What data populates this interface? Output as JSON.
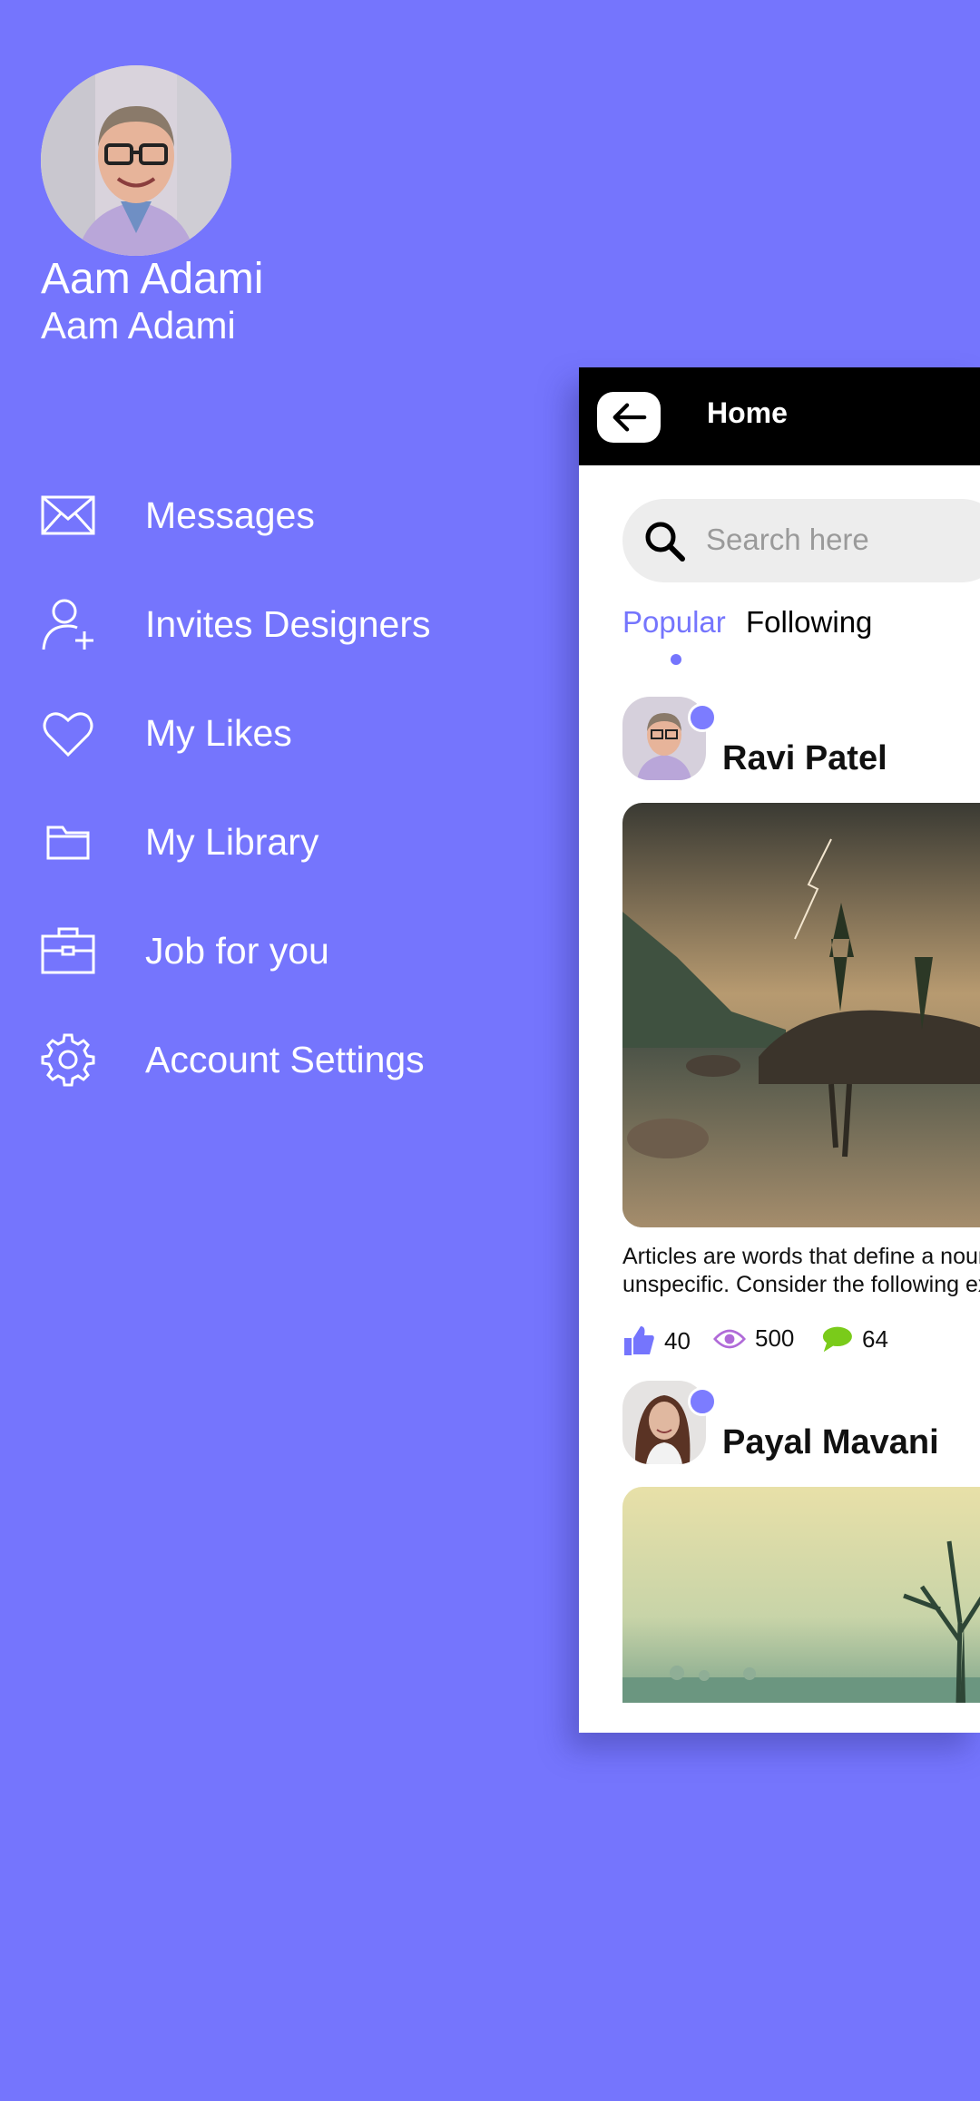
{
  "profile": {
    "name": "Aam Adami",
    "subtitle": "Aam Adami"
  },
  "menu": [
    {
      "label": "Messages",
      "icon": "envelope-icon"
    },
    {
      "label": "Invites Designers",
      "icon": "add-user-icon"
    },
    {
      "label": "My Likes",
      "icon": "heart-icon"
    },
    {
      "label": "My Library",
      "icon": "folder-icon"
    },
    {
      "label": "Job for you",
      "icon": "briefcase-icon"
    },
    {
      "label": "Account Settings",
      "icon": "gear-icon"
    }
  ],
  "phone": {
    "title": "Home",
    "search": {
      "placeholder": "Search here"
    },
    "tabs": [
      {
        "label": "Popular",
        "active": true
      },
      {
        "label": "Following",
        "active": false
      }
    ],
    "posts": [
      {
        "author": "Ravi Patel",
        "text_line1": "Articles are words that define a noun as specific or",
        "text_line2": "unspecific. Consider the following examples",
        "likes": "40",
        "views": "500",
        "comments": "64"
      },
      {
        "author": "Payal Mavani"
      }
    ]
  },
  "colors": {
    "background": "#7575fd",
    "accent": "#7575fd",
    "like": "#7575fd",
    "view": "#b06ad8",
    "comment": "#7acb1a",
    "topbar": "#000000"
  }
}
